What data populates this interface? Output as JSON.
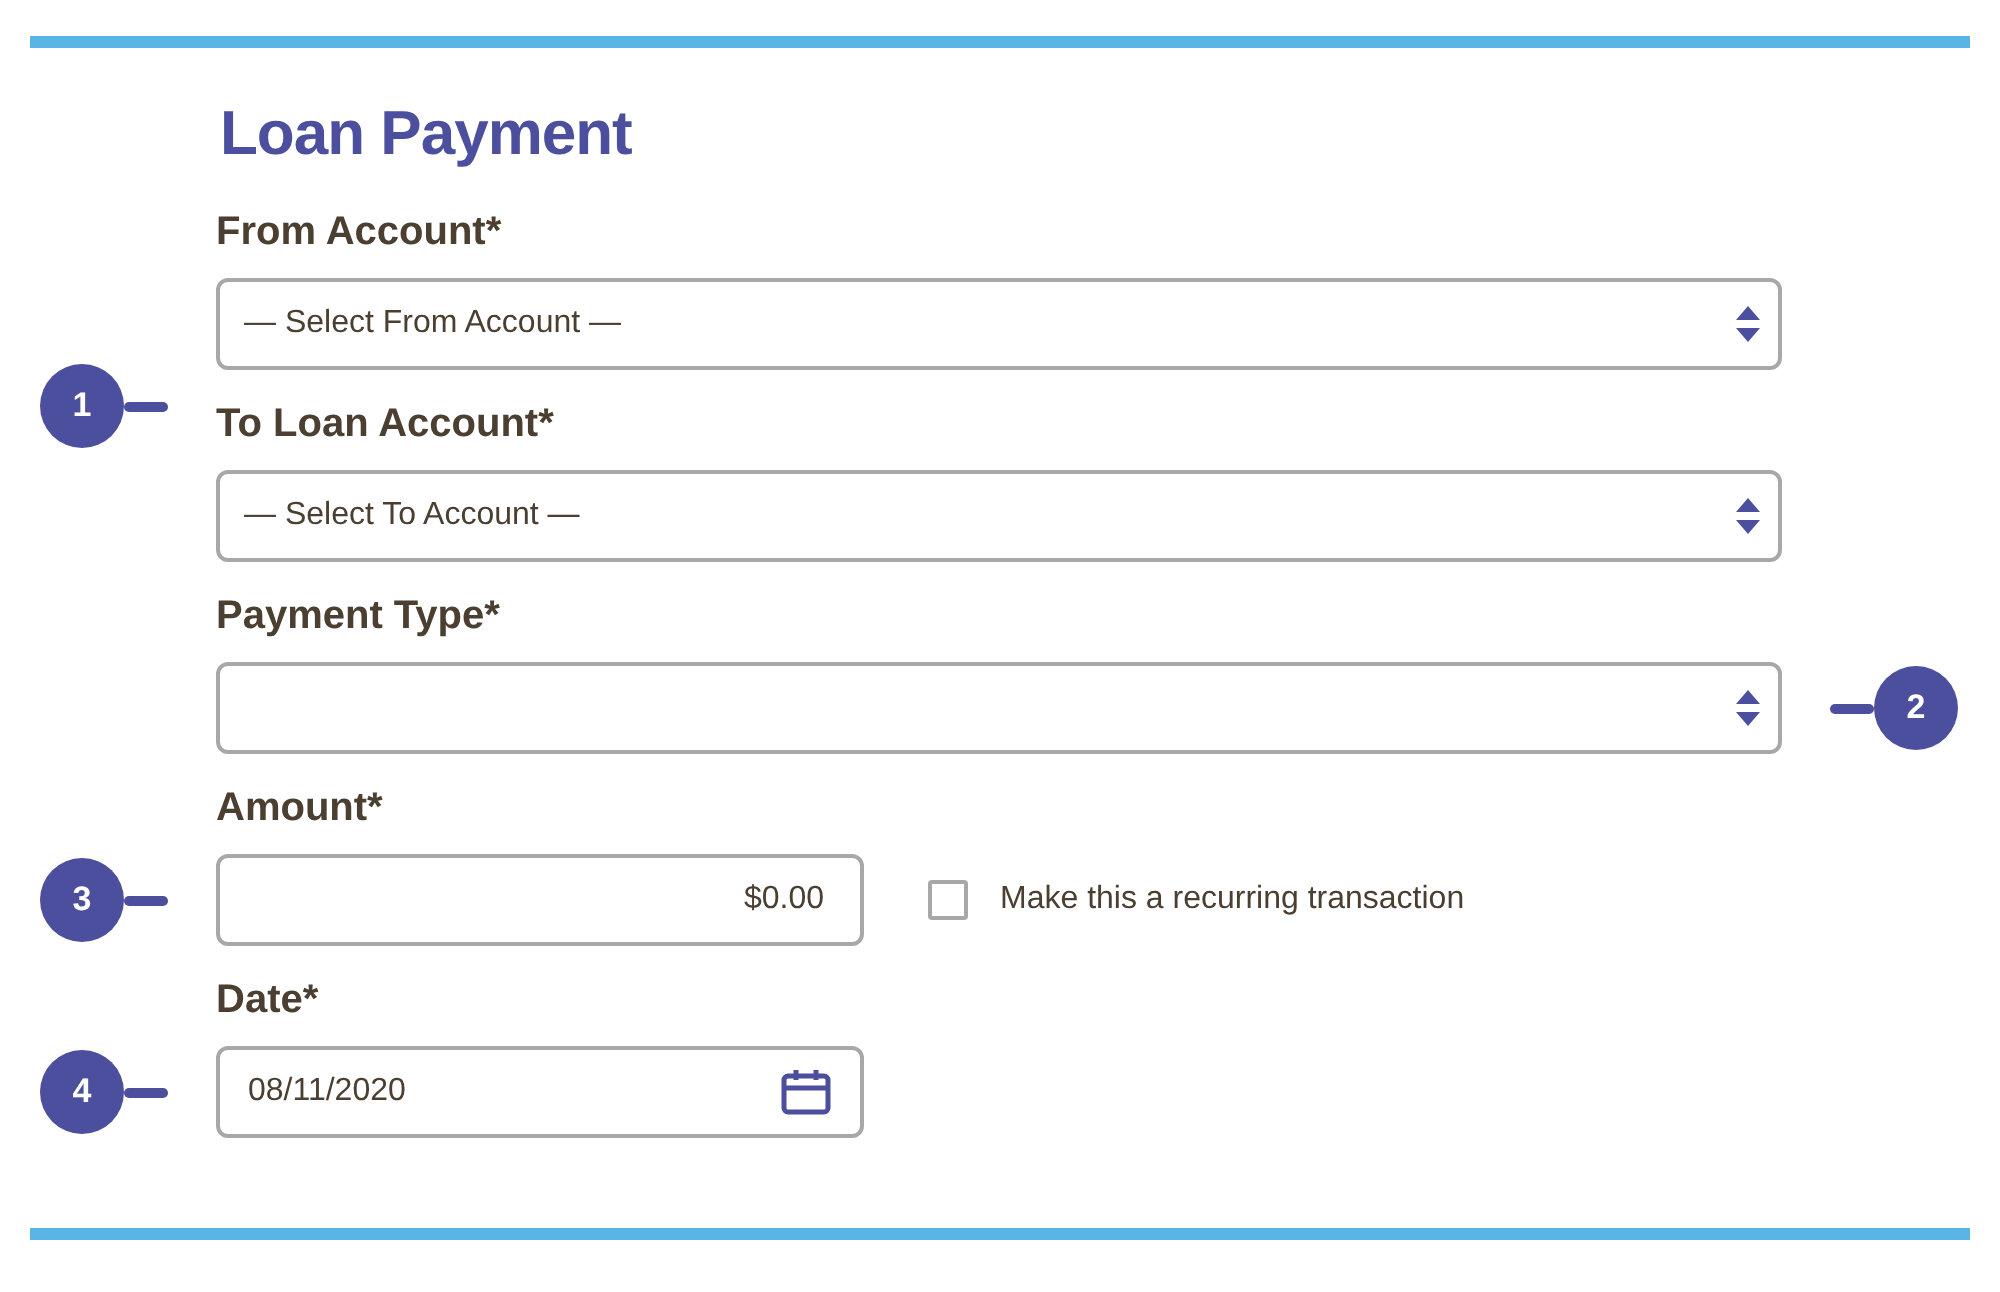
{
  "title": "Loan Payment",
  "fields": [
    {
      "kind": "select",
      "label": "From Account*",
      "value": "— Select From Account —"
    },
    {
      "kind": "select",
      "label": "To Loan Account*",
      "value": "— Select To Account —",
      "callout": {
        "number": "1",
        "kind": "above"
      }
    },
    {
      "kind": "select",
      "label": "Payment Type*",
      "callout": {
        "number": "2",
        "kind": "right"
      }
    },
    {
      "kind": "amount",
      "label": "Amount*",
      "value": "$0.00",
      "callout": {
        "number": "3",
        "kind": "left"
      },
      "checkbox": {
        "label": "Make this a recurring transaction",
        "checked": false
      }
    },
    {
      "kind": "date",
      "label": "Date*",
      "value": "08/11/2020",
      "callout": {
        "number": "4",
        "kind": "left"
      }
    }
  ]
}
